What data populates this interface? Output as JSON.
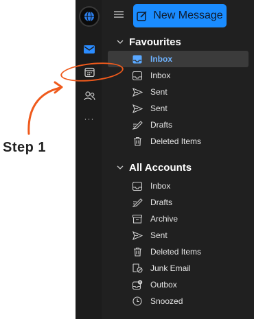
{
  "toolbar": {
    "new_message_label": "New Message"
  },
  "rail": {
    "icons": [
      "mail-icon",
      "calendar-icon",
      "people-icon",
      "more-icon"
    ],
    "more_label": "···"
  },
  "favourites": {
    "header": "Favourites",
    "items": [
      {
        "label": "Inbox",
        "icon": "inbox-icon",
        "selected": true
      },
      {
        "label": "Inbox",
        "icon": "inbox-icon"
      },
      {
        "label": "Sent",
        "icon": "sent-icon"
      },
      {
        "label": "Sent",
        "icon": "sent-icon"
      },
      {
        "label": "Drafts",
        "icon": "drafts-icon"
      },
      {
        "label": "Deleted Items",
        "icon": "trash-icon"
      }
    ]
  },
  "all_accounts": {
    "header": "All Accounts",
    "items": [
      {
        "label": "Inbox",
        "icon": "inbox-icon"
      },
      {
        "label": "Drafts",
        "icon": "drafts-icon"
      },
      {
        "label": "Archive",
        "icon": "archive-icon"
      },
      {
        "label": "Sent",
        "icon": "sent-icon"
      },
      {
        "label": "Deleted Items",
        "icon": "trash-icon"
      },
      {
        "label": "Junk Email",
        "icon": "junk-icon"
      },
      {
        "label": "Outbox",
        "icon": "outbox-icon"
      },
      {
        "label": "Snoozed",
        "icon": "clock-icon"
      }
    ]
  },
  "annotation": {
    "step_label": "Step 1"
  },
  "colors": {
    "accent": "#1a8cff",
    "annotation": "#ef5a1c",
    "background": "#202020",
    "selected_text": "#6fb3ff"
  }
}
